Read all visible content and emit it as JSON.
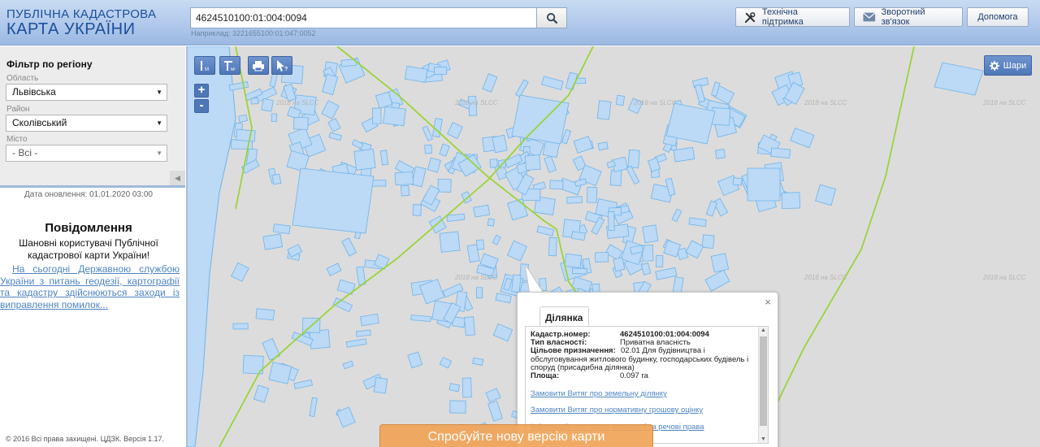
{
  "header": {
    "logo_line1": "ПУБЛІЧНА КАДАСТРОВА",
    "logo_line2": "КАРТА УКРАЇНИ",
    "search_value": "4624510100:01:004:0094",
    "search_hint": "Наприклад: 3221655100:01:047:0052",
    "support_label": "Технічна підтримка",
    "feedback_label": "Зворотний зв'язок",
    "help_label": "Допомога"
  },
  "sidebar": {
    "filter_title": "Фільтр по регіону",
    "fields": [
      {
        "label": "Область",
        "value": "Львівська"
      },
      {
        "label": "Район",
        "value": "Сколівський"
      },
      {
        "label": "Місто",
        "value": "- Всі -"
      }
    ],
    "update_date": "Дата оновлення: 01.01.2020 03:00",
    "notice_title": "Повідомлення",
    "notice_subtitle": "Шановні користувачі Публічної кадастрової карти України!",
    "notice_link": "На сьогодні Державною службою України з питань геодезії, картографії та кадастру здійснюються заходи із виправлення помилок...",
    "copyright": "© 2016 Всі права захищені. ЦДЗК. Версія 1.17."
  },
  "map": {
    "layers_label": "Шари",
    "watermark": "2018 на SLCC",
    "zoom_in": "+",
    "zoom_out": "-",
    "banner": "Спробуйте нову версію карти",
    "colors": {
      "parcel_fill": "#bcd9f5",
      "parcel_stroke": "#6fb4ea",
      "boundary": "#9bd43a",
      "background": "#dcdcdc"
    }
  },
  "popup": {
    "close": "×",
    "tab": "Ділянка",
    "cadastral_label": "Кадастр.номер:",
    "cadastral_value": "4624510100:01:004:0094",
    "ownership_label": "Тип власності:",
    "ownership_value": "Приватна власність",
    "purpose_label": "Цільове призначення:",
    "purpose_value": "02.01 Для будівництва і обслуговування житлового будинку, господарських будівель і споруд (присадибна ділянка)",
    "area_label": "Площа:",
    "area_value": "0.097 га",
    "links": [
      "Замовити Витяг про земельну ділянку",
      "Замовити Витяг про нормативну грошову оцінку",
      "Інформація про право власності та речові права"
    ]
  }
}
